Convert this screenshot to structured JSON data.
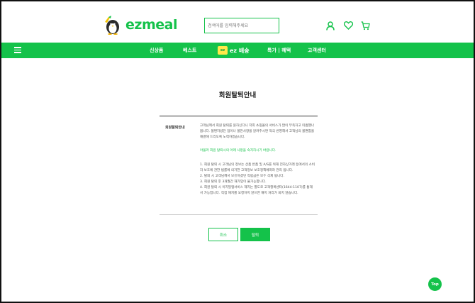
{
  "header": {
    "logo_text": "ezmeal",
    "search_placeholder": "검색어를 입력해주세요",
    "icons": [
      "user-icon",
      "heart-icon",
      "cart-icon"
    ]
  },
  "nav": {
    "items": [
      "신상품",
      "베스트",
      "특가 | 혜택",
      "고객센터"
    ],
    "ez_delivery_badge": "ez",
    "ez_delivery_label": "ez 배송"
  },
  "main": {
    "title": "회원탈퇴안내",
    "section_label": "회원탈퇴안내",
    "intro": "고객님께서 회원 탈퇴를 원하신다니 저희 쇼핑몰의 서비스가 많이 부족하고 미흡했나 봅니다. 불편하셨던 점이나 불만사항을 알려주시면 적극 반영해서 고객님의 불편함을 해결해 드리도록 노력하겠습니다.",
    "notice": "아울러 회원 탈퇴시의 아래 사항을 숙지하시기 바랍니다.",
    "rules": "1. 회원 탈퇴 시 고객님의 정보는 상품 반품 및 A/S를 위해 전자상거래 등에서의 소비자 보호에 관한 법률에 의거한 고객정보 보호정책에따라 관리 됩니다.\n2. 탈퇴 시 고객님께서 보유하셨던 적립금은 모두 삭제 됩니다.\n3. 회원 탈퇴 후 3개월간 재가입이 불가능합니다.\n4. 회원 탈퇴 시 이지밀앱서비스 해지는 별도로 고객행복센터(1644-1107)를 통해서 가능합니다. 직접 해지를 요청하지 않으면 해지 처리가 되지 않습니다.",
    "cancel_label": "취소",
    "withdraw_label": "탈퇴"
  },
  "top_button_label": "Top",
  "colors": {
    "brand": "#14c24a",
    "accent": "#ffe94a"
  }
}
